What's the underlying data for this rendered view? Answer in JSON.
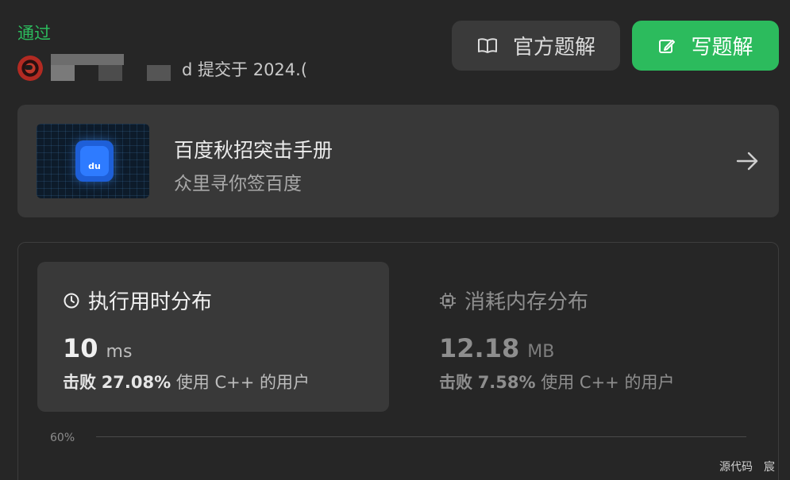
{
  "status": {
    "label": "通过",
    "color": "#2cbb5d"
  },
  "submission": {
    "user_partial": "d",
    "submitted_text": "提交于 2024.("
  },
  "header_buttons": {
    "official_solution": "官方题解",
    "write_solution": "写题解"
  },
  "promo": {
    "title": "百度秋招突击手册",
    "subtitle": "众里寻你签百度",
    "logo_text": "du"
  },
  "runtime": {
    "title": "执行用时分布",
    "value": "10",
    "unit": "ms",
    "beat_prefix": "击败",
    "beat_percent": "27.08%",
    "beat_suffix": "使用 C++ 的用户"
  },
  "memory": {
    "title": "消耗内存分布",
    "value": "12.18",
    "unit": "MB",
    "beat_prefix": "击败",
    "beat_percent": "7.58%",
    "beat_suffix": "使用 C++ 的用户"
  },
  "chart": {
    "axis_label": "60%"
  },
  "footer": {
    "source_code": "源代码",
    "extra": "宸"
  },
  "colors": {
    "accent_green": "#2cbb5d",
    "background": "#262626",
    "card": "#383838"
  }
}
